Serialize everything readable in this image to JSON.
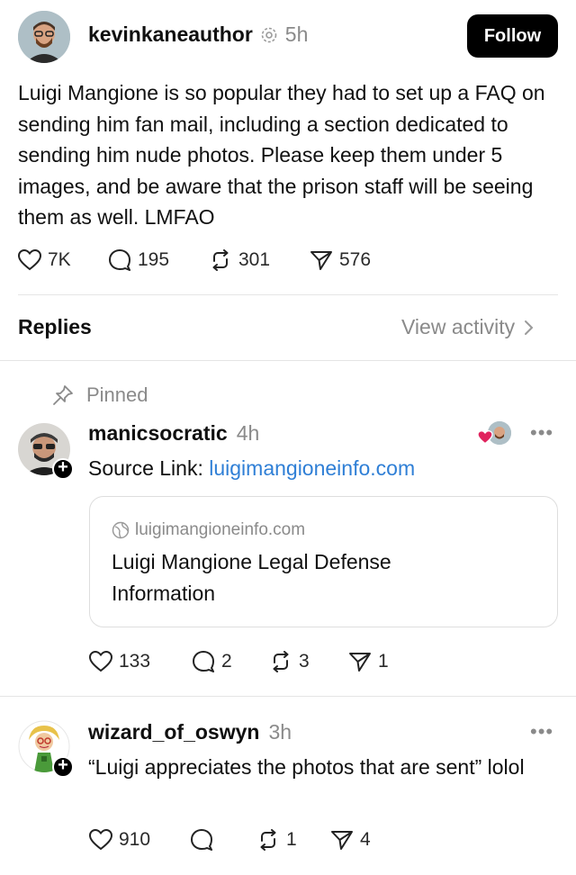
{
  "post": {
    "username": "kevinkaneauthor",
    "time": "5h",
    "follow_label": "Follow",
    "body": "Luigi Mangione is so popular they had to set up a FAQ on sending him fan mail, including a section dedicated to sending him nude photos. Please keep them under 5 images, and be aware that the prison staff will be seeing them as well. LMFAO",
    "stats": {
      "likes": "7K",
      "replies": "195",
      "reposts": "301",
      "shares": "576"
    }
  },
  "replies_header": {
    "title": "Replies",
    "view_activity": "View activity"
  },
  "pinned_reply": {
    "pinned_label": "Pinned",
    "username": "manicsocratic",
    "time": "4h",
    "text_prefix": "Source Link: ",
    "link_text": "luigimangioneinfo.com",
    "card": {
      "domain": "luigimangioneinfo.com",
      "title": "Luigi Mangione Legal Defense Information"
    },
    "stats": {
      "likes": "133",
      "replies": "2",
      "reposts": "3",
      "shares": "1"
    }
  },
  "reply2": {
    "username": "wizard_of_oswyn",
    "time": "3h",
    "text": "“Luigi appreciates the photos that are sent” lolol",
    "stats": {
      "likes": "910",
      "replies": "",
      "reposts": "1",
      "shares": "4"
    }
  },
  "colors": {
    "link": "#2f7fd6",
    "like_heart": "#e0245e",
    "button_bg": "#000000"
  }
}
